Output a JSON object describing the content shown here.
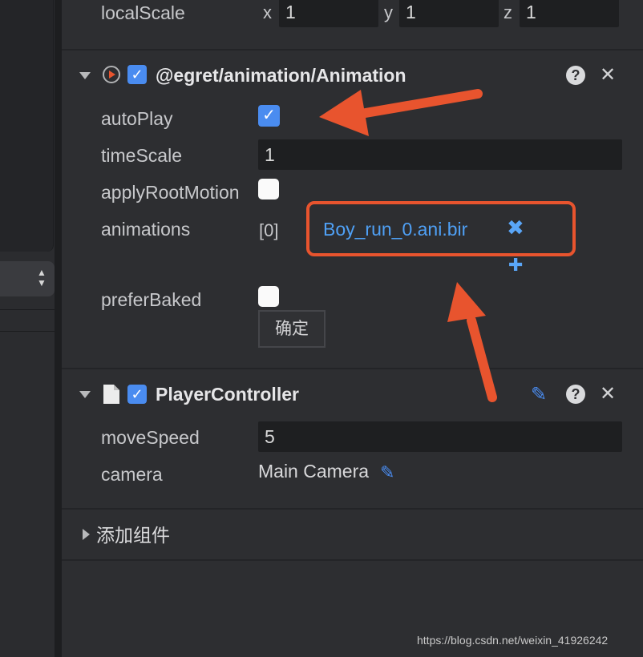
{
  "transform": {
    "scale_label": "localScale",
    "x_axis": "x",
    "x_value": "1",
    "y_axis": "y",
    "y_value": "1",
    "z_axis": "z",
    "z_value": "1"
  },
  "animation_component": {
    "title": "@egret/animation/Animation",
    "help_glyph": "?",
    "close_glyph": "✕",
    "autoplay_label": "autoPlay",
    "autoplay_checked": true,
    "timescale_label": "timeScale",
    "timescale_value": "1",
    "applyrootmotion_label": "applyRootMotion",
    "animations_label": "animations",
    "animations_index": "[0]",
    "animations_item": "Boy_run_0.ani.bir",
    "remove_glyph": "✖",
    "add_glyph": "✚",
    "preferbaked_label": "preferBaked",
    "confirm_label": "确定"
  },
  "player_controller": {
    "title": "PlayerController",
    "edit_glyph": "✎",
    "help_glyph": "?",
    "close_glyph": "✕",
    "movespeed_label": "moveSpeed",
    "movespeed_value": "5",
    "camera_label": "camera",
    "camera_value": "Main Camera"
  },
  "add_component_label": "添加组件",
  "left_select_arrows": "▲▼",
  "watermark": "https://blog.csdn.net/weixin_41926242",
  "colors": {
    "accent_blue": "#4a8cf0",
    "annotation_red": "#e8542e",
    "link_blue": "#4fa0f5"
  }
}
